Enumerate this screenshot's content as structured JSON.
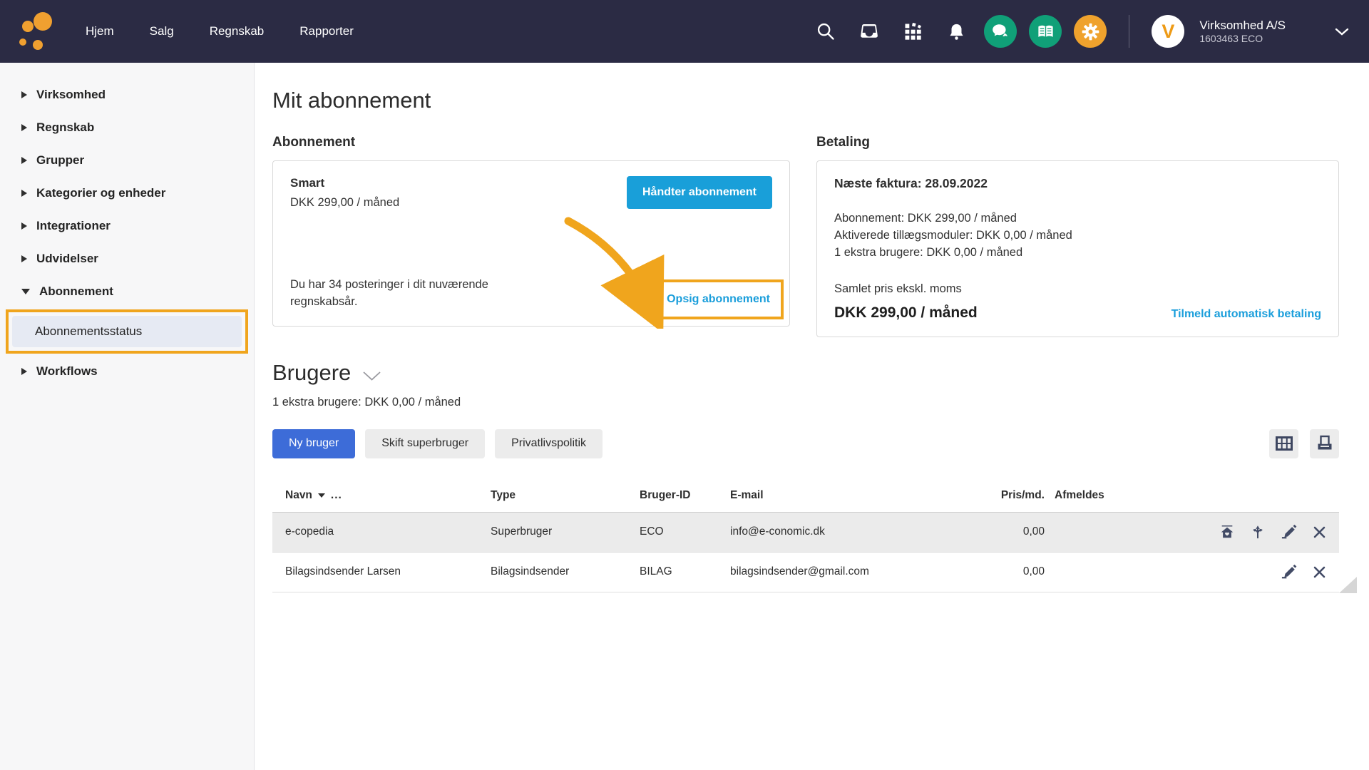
{
  "navbar": {
    "menu": [
      {
        "label": "Hjem"
      },
      {
        "label": "Salg"
      },
      {
        "label": "Regnskab"
      },
      {
        "label": "Rapporter"
      }
    ],
    "company": {
      "name": "Virksomhed A/S",
      "id": "1603463 ECO",
      "avatar_letter": "V"
    },
    "icons": [
      "search-icon",
      "inbox-icon",
      "apps-icon",
      "bell-icon",
      "chat-icon",
      "book-icon",
      "gear-icon"
    ]
  },
  "sidebar": {
    "items": [
      {
        "label": "Virksomhed"
      },
      {
        "label": "Regnskab"
      },
      {
        "label": "Grupper"
      },
      {
        "label": "Kategorier og enheder"
      },
      {
        "label": "Integrationer"
      },
      {
        "label": "Udvidelser"
      },
      {
        "label": "Abonnement",
        "expanded": true
      },
      {
        "label": "Abonnementsstatus",
        "selected": true,
        "annotated": true
      },
      {
        "label": "Workflows"
      }
    ]
  },
  "main": {
    "title": "Mit abonnement",
    "subscription": {
      "heading": "Abonnement",
      "plan_name": "Smart",
      "plan_price": "DKK 299,00 / måned",
      "manage_button": "Håndter abonnement",
      "postings_note": "Du har 34 posteringer i dit nuværende regnskabsår.",
      "cancel_link": "Opsig abonnement"
    },
    "payment": {
      "heading": "Betaling",
      "next_invoice": "Næste faktura: 28.09.2022",
      "lines": [
        "Abonnement: DKK 299,00 / måned",
        "Aktiverede tillægsmoduler: DKK 0,00 / måned",
        "1 ekstra brugere: DKK 0,00 / måned"
      ],
      "total_label": "Samlet pris ekskl. moms",
      "total_value": "DKK 299,00 / måned",
      "autopay_link": "Tilmeld automatisk betaling"
    },
    "users": {
      "heading": "Brugere",
      "extra_users_note": "1 ekstra brugere: DKK 0,00 / måned",
      "buttons": {
        "new_user": "Ny bruger",
        "change_superuser": "Skift superbruger",
        "privacy": "Privatlivspolitik"
      },
      "toolbar_icons": [
        "table-grid-icon",
        "print-icon"
      ],
      "table": {
        "columns": [
          "Navn",
          "Type",
          "Bruger-ID",
          "E-mail",
          "Pris/md.",
          "Afmeldes"
        ],
        "header_menu": "...",
        "rows": [
          {
            "name": "e-copedia",
            "type": "Superbruger",
            "user_id": "ECO",
            "email": "info@e-conomic.dk",
            "price": "0,00",
            "afmeldes": "",
            "actions": [
              "home-icon",
              "redirect-icon",
              "edit-icon",
              "remove-icon"
            ]
          },
          {
            "name": "Bilagsindsender Larsen",
            "type": "Bilagsindsender",
            "user_id": "BILAG",
            "email": "bilagsindsender@gmail.com",
            "price": "0,00",
            "afmeldes": "",
            "actions": [
              "edit-icon",
              "remove-icon"
            ]
          }
        ]
      }
    }
  },
  "annotations": {
    "highlight_color": "#f0a51d",
    "highlighted_items": [
      "Abonnementsstatus",
      "Opsig abonnement"
    ],
    "arrow_points_to": "Opsig abonnement"
  },
  "colors": {
    "navbar_bg": "#2b2b44",
    "brand_orange": "#f0a030",
    "brand_green": "#10a078",
    "cyan_button": "#199fd9",
    "royal_button": "#3d6cd8",
    "link_blue": "#1a9edb",
    "selected_item_bg": "#e6eaf3",
    "row_alt_bg": "#ebebeb"
  }
}
